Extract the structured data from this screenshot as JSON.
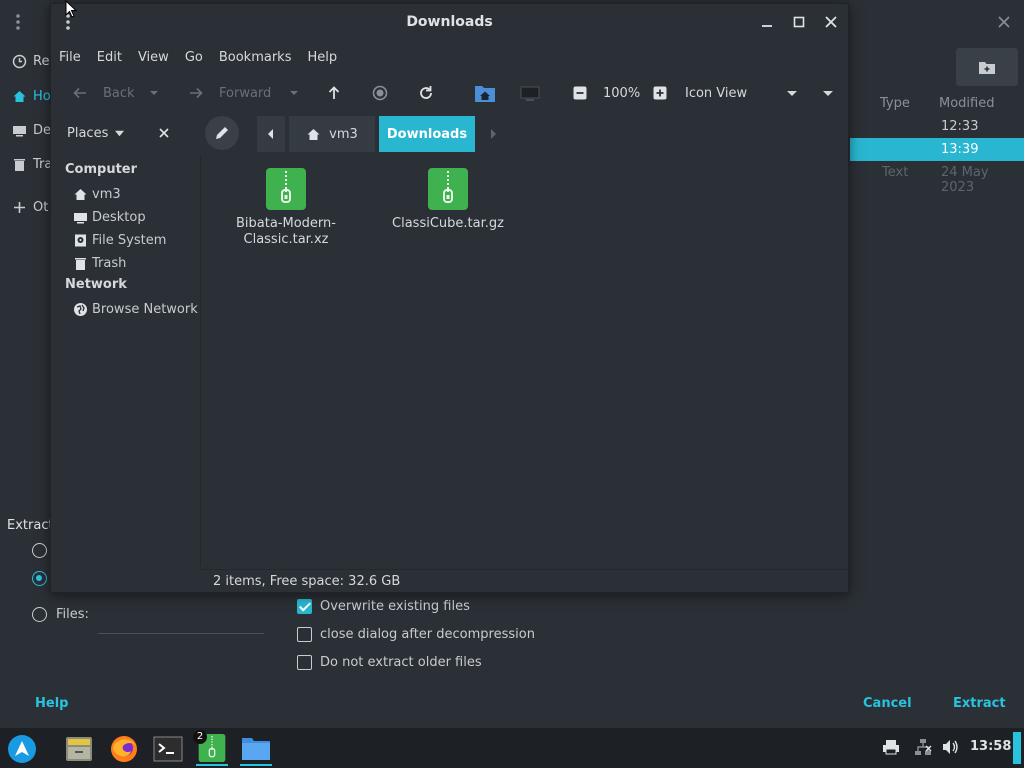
{
  "colors": {
    "accent": "#29b6d1",
    "accent_text": "#29c3e0",
    "window_bg": "#2b3036",
    "taskbar_bg": "#1d2024",
    "archive_green": "#3fb14f"
  },
  "background_dialog": {
    "sidebar": [
      {
        "label": "Re",
        "icon": "clock-icon"
      },
      {
        "label": "Ho",
        "icon": "home-icon"
      },
      {
        "label": "De",
        "icon": "desktop-icon"
      },
      {
        "label": "Tra",
        "icon": "trash-icon"
      },
      {
        "label": "Ot",
        "icon": "plus-icon"
      }
    ],
    "columns": {
      "type": "Type",
      "modified": "Modified"
    },
    "rows": [
      {
        "type": "",
        "modified": "12:33"
      },
      {
        "type": "",
        "modified": "13:39"
      },
      {
        "type": "Text",
        "modified": "24 May 2023"
      }
    ],
    "extract_label": "Extract",
    "files_label": "Files:",
    "options": [
      {
        "label": "Overwrite existing files",
        "checked": true
      },
      {
        "label": "close dialog after decompression",
        "checked": false
      },
      {
        "label": "Do not extract older files",
        "checked": false
      }
    ],
    "help_button": "Help",
    "cancel_button": "Cancel",
    "extract_button": "Extract"
  },
  "file_manager": {
    "title": "Downloads",
    "menu": [
      "File",
      "Edit",
      "View",
      "Go",
      "Bookmarks",
      "Help"
    ],
    "toolbar": {
      "back": "Back",
      "forward": "Forward",
      "zoom": "100%",
      "view_mode": "Icon View"
    },
    "places_label": "Places",
    "breadcrumb": {
      "home": "vm3",
      "current": "Downloads"
    },
    "sidebar": {
      "computer_heading": "Computer",
      "computer_items": [
        {
          "label": "vm3",
          "icon": "home-icon"
        },
        {
          "label": "Desktop",
          "icon": "desktop-icon"
        },
        {
          "label": "File System",
          "icon": "drive-icon"
        },
        {
          "label": "Trash",
          "icon": "trash-icon"
        }
      ],
      "network_heading": "Network",
      "network_items": [
        {
          "label": "Browse Network",
          "icon": "network-icon"
        }
      ]
    },
    "files": [
      {
        "name_line1": "Bibata-Modern-",
        "name_line2": "Classic.tar.xz",
        "icon": "archive-icon"
      },
      {
        "name_line1": "ClassiCube.tar.gz",
        "name_line2": "",
        "icon": "archive-icon"
      }
    ],
    "status": "2 items, Free space: 32.6 GB"
  },
  "taskbar": {
    "apps": [
      "start-menu-icon",
      "file-cabinet-icon",
      "firefox-icon",
      "terminal-icon",
      "archive-manager-icon",
      "file-manager-icon"
    ],
    "badge": "2",
    "clock": "13:58"
  }
}
